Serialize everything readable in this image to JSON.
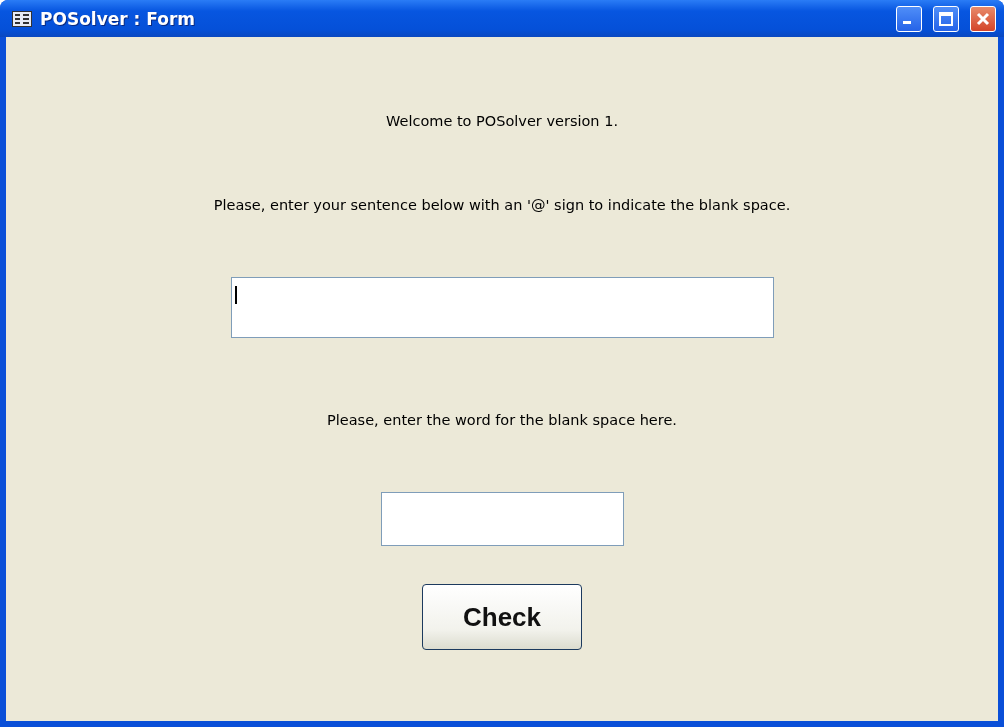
{
  "window": {
    "title": "POSolver : Form"
  },
  "window_controls": [
    {
      "kind": "minimize"
    },
    {
      "kind": "maximize"
    },
    {
      "kind": "close"
    }
  ],
  "form": [
    {
      "kind": "label",
      "text": "Welcome to POSolver version 1."
    },
    {
      "kind": "label",
      "text": "Please, enter your sentence below with an '@' sign to indicate the blank space."
    },
    {
      "kind": "longfield",
      "focused": true
    },
    {
      "kind": "label",
      "text": "Please, enter the word for the blank space here."
    },
    {
      "kind": "shortfield",
      "focused": false
    },
    {
      "kind": "button",
      "label": "Check"
    }
  ]
}
